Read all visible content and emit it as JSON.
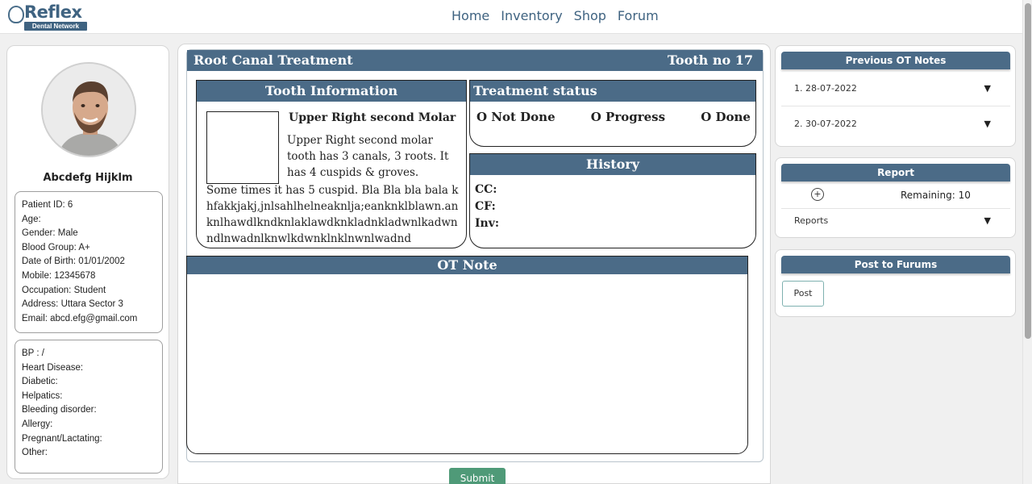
{
  "brand": {
    "name": "Reflex",
    "tagline": "Dental Network"
  },
  "nav": [
    "Home",
    "Inventory",
    "Shop",
    "Forum"
  ],
  "patient": {
    "name": "Abcdefg Hijklm",
    "details": [
      "Patient ID: 6",
      "Age:",
      "Gender: Male",
      "Blood Group: A+",
      "Date of Birth: 01/01/2002",
      "Mobile: 12345678",
      "Occupation: Student",
      "Address: Uttara Sector 3",
      "Email: abcd.efg@gmail.com"
    ],
    "medical": [
      "BP : /",
      "Heart Disease:",
      "Diabetic:",
      "Helpatics:",
      "Bleeding disorder:",
      "Allergy:",
      "Pregnant/Lactating:",
      "Other:"
    ]
  },
  "treatment": {
    "title": "Root Canal Treatment",
    "tooth": "Tooth no 17",
    "tooth_info": {
      "heading": "Tooth Information",
      "name": "Upper Right second Molar",
      "desc": "Upper Right second molar tooth has 3 canals, 3 roots. It has 4 cuspids & groves.",
      "more": "Some times it has 5 cuspid. Bla Bla bla bala khfakkjakj,jnlsahlhelneaknlja;eanknklblawn.anknlhawdlkndknlaklawdknkladnkladwnlkadwnndlnwadnlknwlkdwnklnklnwnlwadnd"
    },
    "status": {
      "heading": "Treatment status",
      "options": [
        "O Not Done",
        "O Progress",
        "O Done"
      ]
    },
    "history": {
      "heading": "History",
      "lines": [
        "CC:",
        "CF:",
        "Inv:"
      ]
    },
    "ot_note": {
      "heading": "OT Note"
    },
    "submit": "Submit"
  },
  "sidebar": {
    "previous_notes": {
      "heading": "Previous OT Notes",
      "items": [
        "1. 28-07-2022",
        "2. 30-07-2022"
      ]
    },
    "report": {
      "heading": "Report",
      "remaining": "Remaining: 10",
      "reports_label": "Reports"
    },
    "post": {
      "heading": "Post to Furums",
      "button": "Post"
    }
  },
  "icons": {
    "logo": "tooth-ring-icon",
    "caret": "caret-down-icon",
    "add": "plus-circle-icon"
  },
  "colors": {
    "header": "#4b6b87",
    "brand": "#3f6381",
    "submit": "#4f9a78"
  }
}
